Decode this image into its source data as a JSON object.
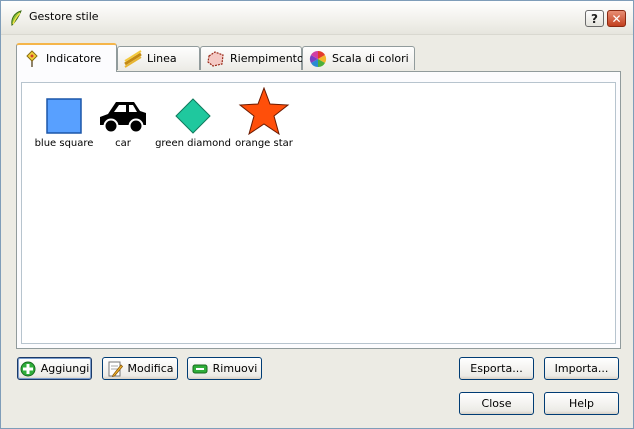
{
  "window": {
    "title": "Gestore stile",
    "help_button": "?",
    "close_button": "✕"
  },
  "tabs": [
    {
      "label": "Indicatore",
      "active": true
    },
    {
      "label": "Linea",
      "active": false
    },
    {
      "label": "Riempimento",
      "active": false
    },
    {
      "label": "Scala di colori",
      "active": false
    }
  ],
  "symbols": [
    {
      "label": "blue square",
      "icon": "blue-square-icon",
      "color": "#58a0ff"
    },
    {
      "label": "car",
      "icon": "car-icon",
      "color": "#000000"
    },
    {
      "label": "green diamond",
      "icon": "green-diamond-icon",
      "color": "#1fc89e"
    },
    {
      "label": "orange star",
      "icon": "orange-star-icon",
      "color": "#ff4f0a"
    }
  ],
  "actions": {
    "add": "Aggiungi",
    "edit": "Modifica",
    "remove": "Rimuovi",
    "export": "Esporta...",
    "import": "Importa..."
  },
  "footer": {
    "close": "Close",
    "help": "Help"
  }
}
